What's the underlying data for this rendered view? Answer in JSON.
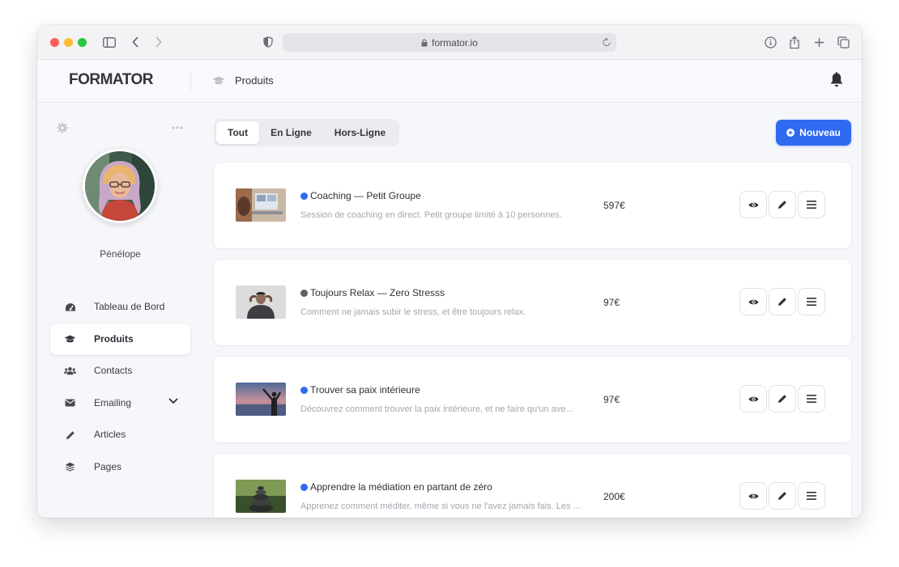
{
  "browser": {
    "url": "formator.io"
  },
  "header": {
    "logo": "FORMATOR",
    "section_title": "Produits"
  },
  "sidebar": {
    "username": "Pénélope",
    "items": [
      {
        "label": "Tableau de Bord",
        "icon": "dashboard-icon"
      },
      {
        "label": "Produits",
        "icon": "graduation-cap-icon",
        "active": true
      },
      {
        "label": "Contacts",
        "icon": "users-icon"
      },
      {
        "label": "Emailing",
        "icon": "envelope-icon",
        "expandable": true
      },
      {
        "label": "Articles",
        "icon": "pencil-icon"
      },
      {
        "label": "Pages",
        "icon": "layers-icon"
      }
    ]
  },
  "tabs": [
    {
      "label": "Tout",
      "active": true
    },
    {
      "label": "En Ligne"
    },
    {
      "label": "Hors-Ligne"
    }
  ],
  "new_button": "Nouveau",
  "products": [
    {
      "title": "Coaching — Petit Groupe",
      "description": "Session de coaching en direct. Petit groupe limité à 10 personnes.",
      "price": "597€",
      "status": "online",
      "status_color": "#2f6bf0"
    },
    {
      "title": "Toujours Relax — Zero Stresss",
      "description": "Comment ne jamais subir le stress, et être toujours relax.",
      "price": "97€",
      "status": "offline",
      "status_color": "#5d5e66"
    },
    {
      "title": "Trouver sa paix intérieure",
      "description": "Découvrez comment trouver la paix intérieure, et ne faire qu'un ave...",
      "price": "97€",
      "status": "online",
      "status_color": "#2f6bf0"
    },
    {
      "title": "Apprendre la médiation en partant de zéro",
      "description": "Apprenez comment méditer, même si vous ne l'avez jamais fais. Les ...",
      "price": "200€",
      "status": "online",
      "status_color": "#2f6bf0"
    }
  ],
  "colors": {
    "accent": "#2f6bf0",
    "online": "#2f6bf0",
    "offline": "#5d5e66"
  }
}
